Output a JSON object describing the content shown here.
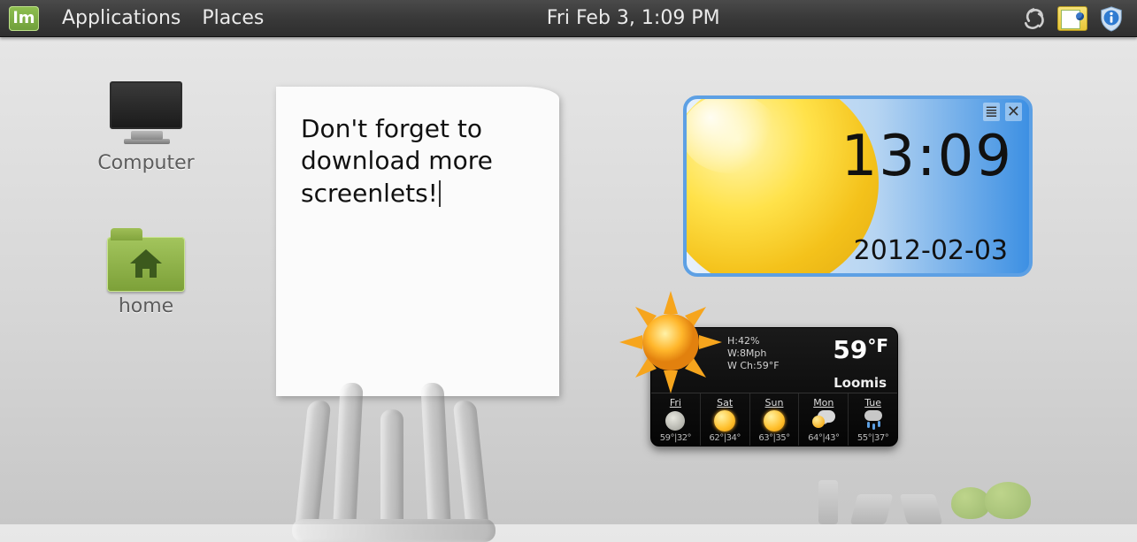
{
  "panel": {
    "applications_label": "Applications",
    "places_label": "Places",
    "clock": "Fri Feb  3,  1:09 PM"
  },
  "desktop": {
    "computer_label": "Computer",
    "home_label": "home"
  },
  "sticky": {
    "text": "Don't forget to download more screenlets!"
  },
  "clock_widget": {
    "time": "13:09",
    "date": "2012-02-03"
  },
  "weather": {
    "humidity": "H:42%",
    "wind": "W:8Mph",
    "windchill": "W Ch:59°F",
    "temp_value": "59",
    "temp_unit": "°F",
    "location": "Loomis",
    "days": [
      {
        "name": "Fri",
        "icon": "moon",
        "hi": "59",
        "lo": "32"
      },
      {
        "name": "Sat",
        "icon": "sun",
        "hi": "62",
        "lo": "34"
      },
      {
        "name": "Sun",
        "icon": "sun",
        "hi": "63",
        "lo": "35"
      },
      {
        "name": "Mon",
        "icon": "partlycloudy",
        "hi": "64",
        "lo": "43"
      },
      {
        "name": "Tue",
        "icon": "rain",
        "hi": "55",
        "lo": "37"
      }
    ]
  }
}
